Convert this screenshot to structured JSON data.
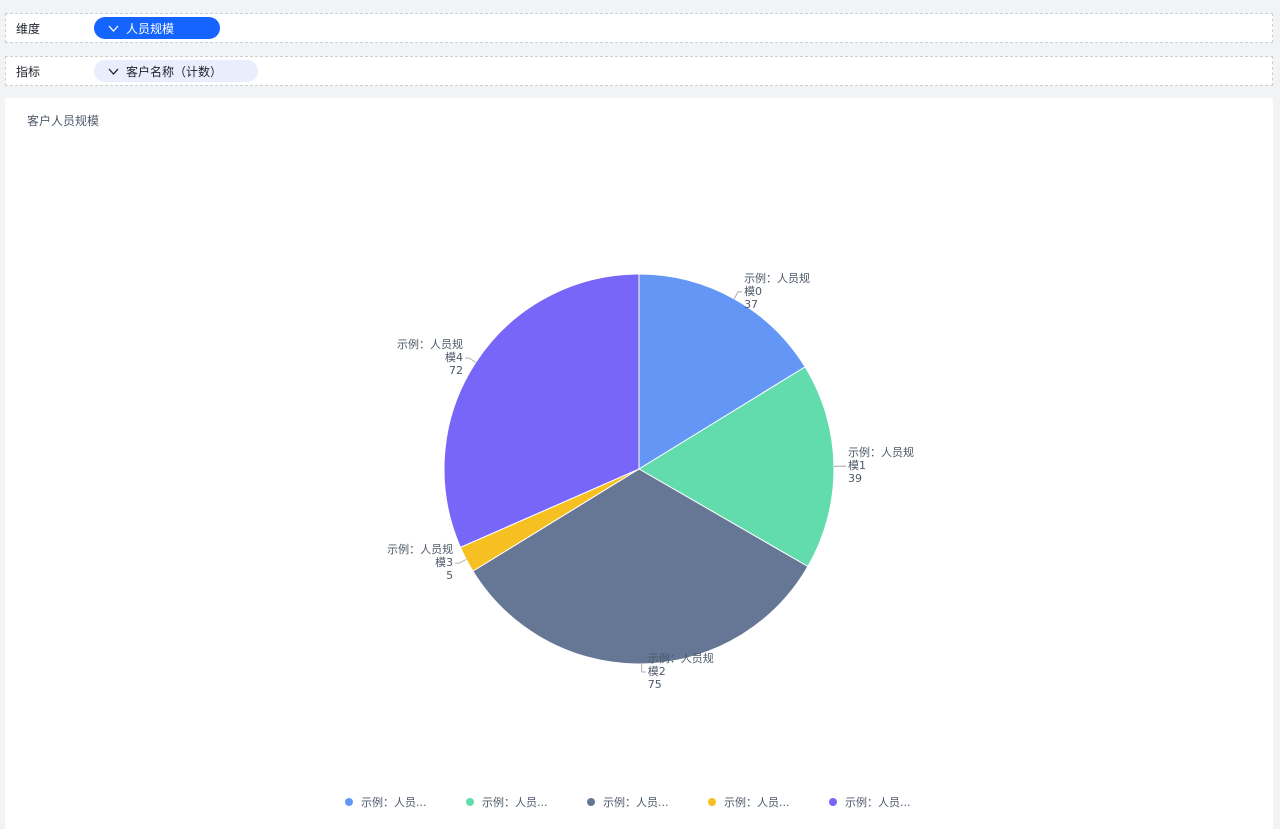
{
  "filters": {
    "dimension_label": "维度",
    "dimension_value": "人员规模",
    "metric_label": "指标",
    "metric_value": "客户名称（计数）"
  },
  "chart": {
    "title": "客户人员规模"
  },
  "colors": {
    "accent": "#1664ff",
    "slice_0": "#6497f5",
    "slice_1": "#62dbad",
    "slice_2": "#657795",
    "slice_3": "#f6c022",
    "slice_4": "#7766f8"
  },
  "chart_data": {
    "type": "pie",
    "title": "客户人员规模",
    "slices": [
      {
        "label_line1": "示例：人员规",
        "label_line2": "模0",
        "value": 37
      },
      {
        "label_line1": "示例：人员规",
        "label_line2": "模1",
        "value": 39
      },
      {
        "label_line1": "示例：人员规",
        "label_line2": "模2",
        "value": 75
      },
      {
        "label_line1": "示例：人员规",
        "label_line2": "模3",
        "value": 5
      },
      {
        "label_line1": "示例：人员规",
        "label_line2": "模4",
        "value": 72
      }
    ],
    "legend": [
      "示例：人员...",
      "示例：人员...",
      "示例：人员...",
      "示例：人员...",
      "示例：人员..."
    ],
    "legend_position": "bottom"
  }
}
